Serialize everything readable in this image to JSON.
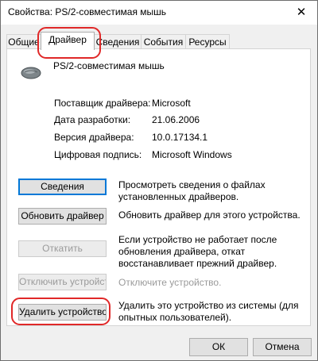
{
  "window": {
    "title": "Свойства: PS/2-совместимая мышь",
    "close_glyph": "✕"
  },
  "tabs": [
    {
      "label": "Общие"
    },
    {
      "label": "Драйвер",
      "selected": true
    },
    {
      "label": "Сведения"
    },
    {
      "label": "События"
    },
    {
      "label": "Ресурсы"
    }
  ],
  "device": {
    "name": "PS/2-совместимая мышь",
    "icon": "mouse-icon"
  },
  "properties": [
    {
      "label": "Поставщик драйвера:",
      "value": "Microsoft"
    },
    {
      "label": "Дата разработки:",
      "value": "21.06.2006"
    },
    {
      "label": "Версия драйвера:",
      "value": "10.0.17134.1"
    },
    {
      "label": "Цифровая подпись:",
      "value": "Microsoft Windows"
    }
  ],
  "actions": [
    {
      "button": "Сведения",
      "description": "Просмотреть сведения о файлах установленных драйверов.",
      "enabled": true
    },
    {
      "button": "Обновить драйвер",
      "description": "Обновить драйвер для этого устройства.",
      "enabled": true
    },
    {
      "button": "Откатить",
      "description": "Если устройство не работает после обновления драйвера, откат восстанавливает прежний драйвер.",
      "enabled": false
    },
    {
      "button": "Отключить устройство",
      "description": "Отключите устройство.",
      "enabled": false
    },
    {
      "button": "Удалить устройство",
      "description": "Удалить это устройство из системы (для опытных пользователей).",
      "enabled": true
    }
  ],
  "footer": {
    "ok_label": "ОК",
    "cancel_label": "Отмена"
  },
  "colors": {
    "highlight": "#e02828",
    "focus_border": "#0078d7",
    "disabled_text": "#9a9a9a"
  }
}
